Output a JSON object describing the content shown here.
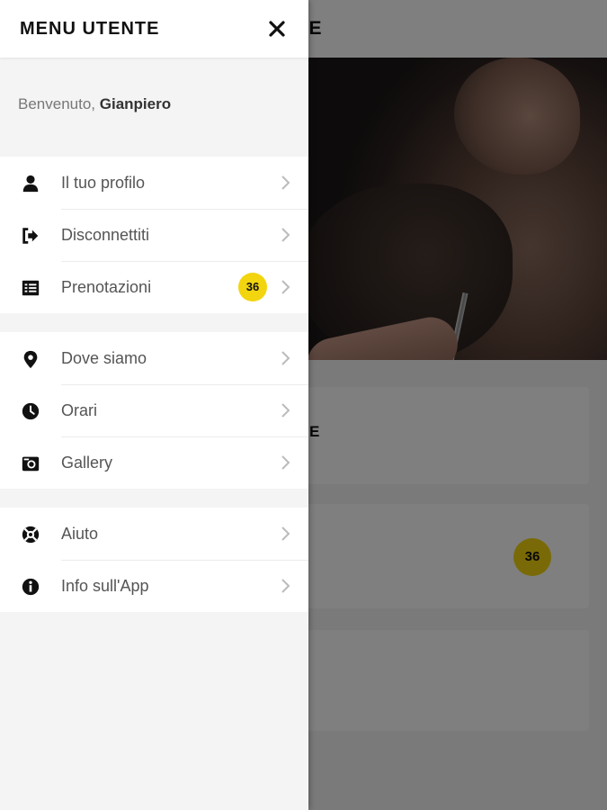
{
  "app": {
    "title": "ERUDE",
    "cards": [
      {
        "title": "E"
      },
      {
        "badge": "36"
      },
      {}
    ]
  },
  "drawer": {
    "title": "MENU UTENTE",
    "welcome_prefix": "Benvenuto, ",
    "user_name": "Gianpiero",
    "groups": [
      {
        "items": [
          {
            "label": "Il tuo profilo",
            "icon": "user-icon"
          },
          {
            "label": "Disconnettiti",
            "icon": "logout-icon"
          },
          {
            "label": "Prenotazioni",
            "icon": "list-icon",
            "badge": "36"
          }
        ]
      },
      {
        "items": [
          {
            "label": "Dove siamo",
            "icon": "location-pin-icon"
          },
          {
            "label": "Orari",
            "icon": "clock-icon"
          },
          {
            "label": "Gallery",
            "icon": "camera-icon"
          }
        ]
      },
      {
        "items": [
          {
            "label": "Aiuto",
            "icon": "lifebuoy-icon"
          },
          {
            "label": "Info sull'App",
            "icon": "info-icon"
          }
        ]
      }
    ]
  },
  "colors": {
    "accent_badge": "#f2d50f",
    "overlay": "rgba(0,0,0,0.5)"
  }
}
